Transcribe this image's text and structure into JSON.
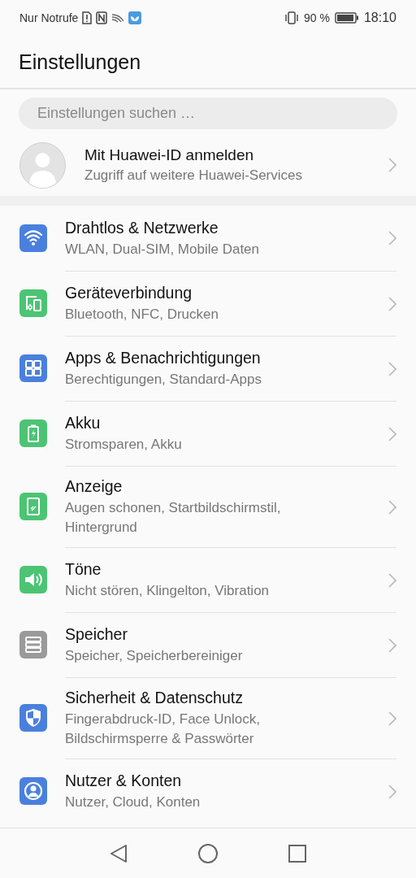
{
  "status_bar": {
    "carrier": "Nur Notrufe",
    "battery_text": "90 %",
    "time": "18:10"
  },
  "title": "Einstellungen",
  "search": {
    "placeholder": "Einstellungen suchen …"
  },
  "account": {
    "title": "Mit Huawei-ID anmelden",
    "subtitle": "Zugriff auf weitere Huawei-Services"
  },
  "items": [
    {
      "kind": "wifi",
      "color": "#4a80dd",
      "title": "Drahtlos & Netzwerke",
      "subtitle": "WLAN, Dual-SIM, Mobile Daten"
    },
    {
      "kind": "devices",
      "color": "#4cc474",
      "title": "Geräteverbindung",
      "subtitle": "Bluetooth, NFC, Drucken"
    },
    {
      "kind": "apps",
      "color": "#4a80dd",
      "title": "Apps & Benachrichtigungen",
      "subtitle": "Berechtigungen, Standard-Apps"
    },
    {
      "kind": "battery",
      "color": "#4cc474",
      "title": "Akku",
      "subtitle": "Stromsparen, Akku"
    },
    {
      "kind": "display",
      "color": "#4cc474",
      "title": "Anzeige",
      "subtitle": "Augen schonen, Startbildschirmstil, Hintergrund"
    },
    {
      "kind": "sound",
      "color": "#4cc474",
      "title": "Töne",
      "subtitle": "Nicht stören, Klingelton, Vibration"
    },
    {
      "kind": "storage",
      "color": "#9a9a9a",
      "title": "Speicher",
      "subtitle": "Speicher, Speicherbereiniger"
    },
    {
      "kind": "shield",
      "color": "#4a80dd",
      "title": "Sicherheit & Datenschutz",
      "subtitle": "Fingerabdruck-ID, Face Unlock, Bildschirmsperre & Passwörter"
    },
    {
      "kind": "user",
      "color": "#4a80dd",
      "title": "Nutzer & Konten",
      "subtitle": "Nutzer, Cloud, Konten"
    }
  ]
}
